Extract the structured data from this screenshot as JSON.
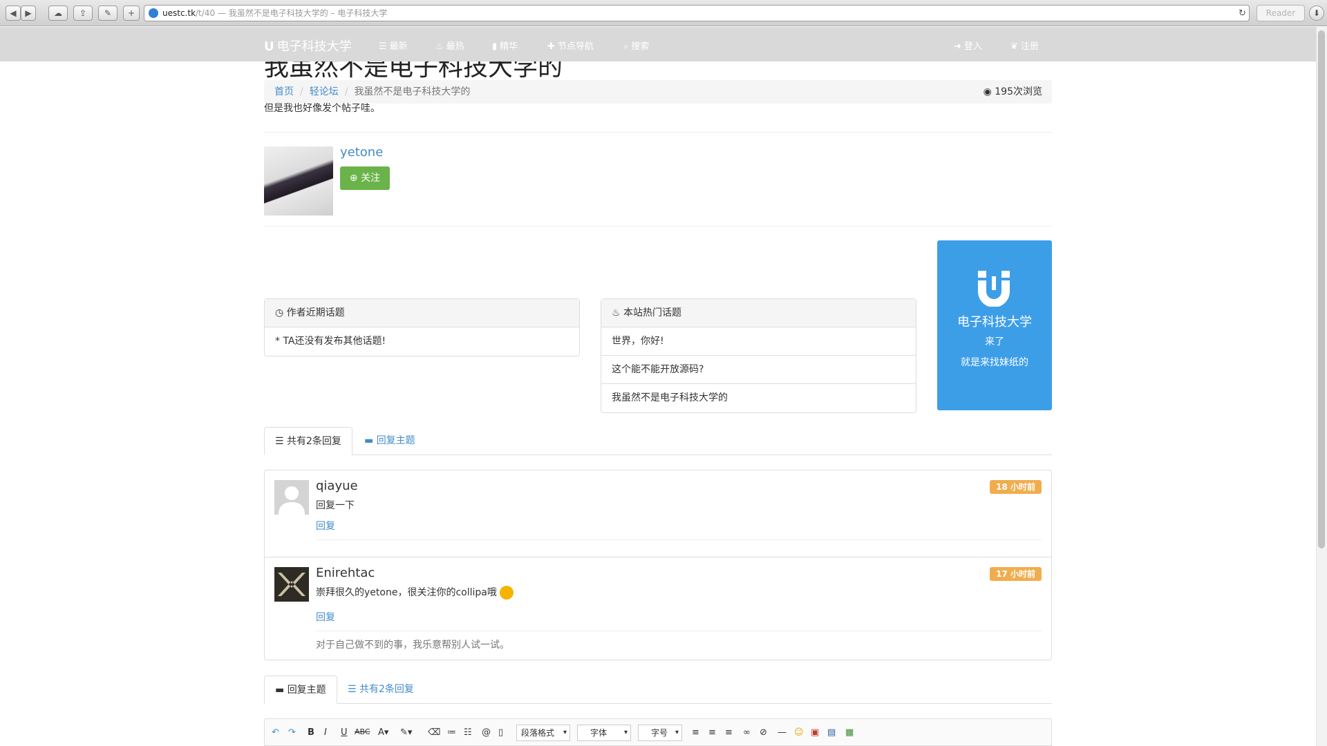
{
  "browser": {
    "url_domain": "uestc.tk",
    "url_path": "/t/40",
    "url_title": " — 我虽然不是电子科技大学的 – 电子科技大学",
    "reader_label": "Reader"
  },
  "navbar": {
    "brand": "电子科技大学",
    "items": [
      {
        "label": "最新",
        "icon": "list-icon"
      },
      {
        "label": "最热",
        "icon": "fire-icon"
      },
      {
        "label": "精华",
        "icon": "bookmark-icon"
      },
      {
        "label": "节点导航",
        "icon": "plus-icon"
      },
      {
        "label": "搜索",
        "icon": "search-icon"
      }
    ],
    "login_label": "登入",
    "register_label": "注册"
  },
  "topic": {
    "title": "我虽然不是电子科技大学的",
    "breadcrumb": [
      "首页",
      "轻论坛",
      "我虽然不是电子科技大学的"
    ],
    "views": "195次浏览",
    "body": "但是我也好像发个帖子哇。"
  },
  "author": {
    "name": "yetone",
    "follow_label": "关注"
  },
  "recent_topics": {
    "title": "作者近期话题",
    "items": [
      "* TA还没有发布其他话题!"
    ]
  },
  "hot_topics": {
    "title": "本站热门话题",
    "items": [
      "世界，你好!",
      "这个能不能开放源码?",
      "我虽然不是电子科技大学的"
    ]
  },
  "promo": {
    "title": "电子科技大学",
    "line1": "来了",
    "line2": "就是来找妹纸的"
  },
  "reply_tabs": {
    "count_label": "共有2条回复",
    "reply_label": "回复主题"
  },
  "replies": [
    {
      "user": "qiayue",
      "text": "回复一下",
      "time": "18 小时前",
      "reply_link": "回复",
      "signature": ""
    },
    {
      "user": "Enirehtac",
      "text": "崇拜很久的yetone，很关注你的collipa哦",
      "time": "17 小时前",
      "reply_link": "回复",
      "signature": "对于自己做不到的事，我乐意帮别人试一试。"
    }
  ],
  "editor": {
    "format_select": "段落格式",
    "font_select": "字体",
    "size_select": "字号"
  }
}
